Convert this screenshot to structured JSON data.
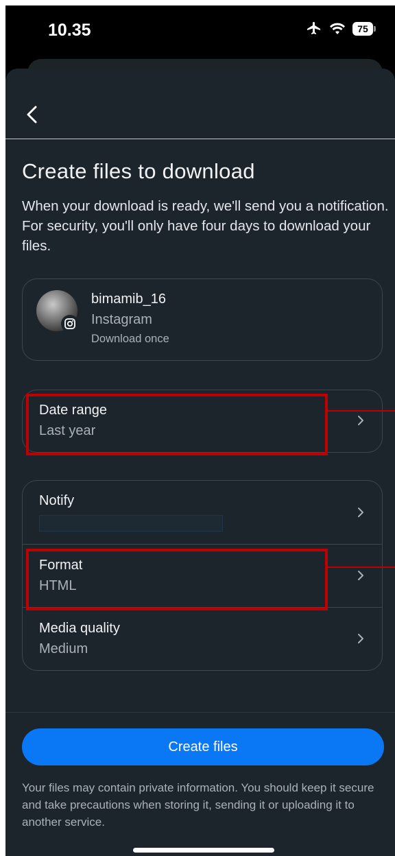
{
  "status_bar": {
    "time": "10.35",
    "battery": "75",
    "icons": [
      "airplane-icon",
      "wifi-icon",
      "battery-icon"
    ]
  },
  "header": {
    "back_icon": "chevron-left-icon"
  },
  "page": {
    "title": "Create files to download",
    "description": "When your download is ready, we'll send you a notification. For security, you'll only have four days to download your files."
  },
  "account": {
    "username": "bimamib_16",
    "app": "Instagram",
    "note": "Download once"
  },
  "date_range": {
    "label": "Date range",
    "value": "Last year"
  },
  "settings": {
    "notify": {
      "label": "Notify",
      "value": ""
    },
    "format": {
      "label": "Format",
      "value": "HTML"
    },
    "media_quality": {
      "label": "Media quality",
      "value": "Medium"
    }
  },
  "footer": {
    "create_button": "Create files",
    "disclaimer": "Your files may contain private information. You should keep it secure and take precautions when storing it, sending it or uploading it to another service."
  },
  "colors": {
    "background": "#1c252c",
    "accent": "#0a78f5",
    "highlight": "#c00000"
  }
}
